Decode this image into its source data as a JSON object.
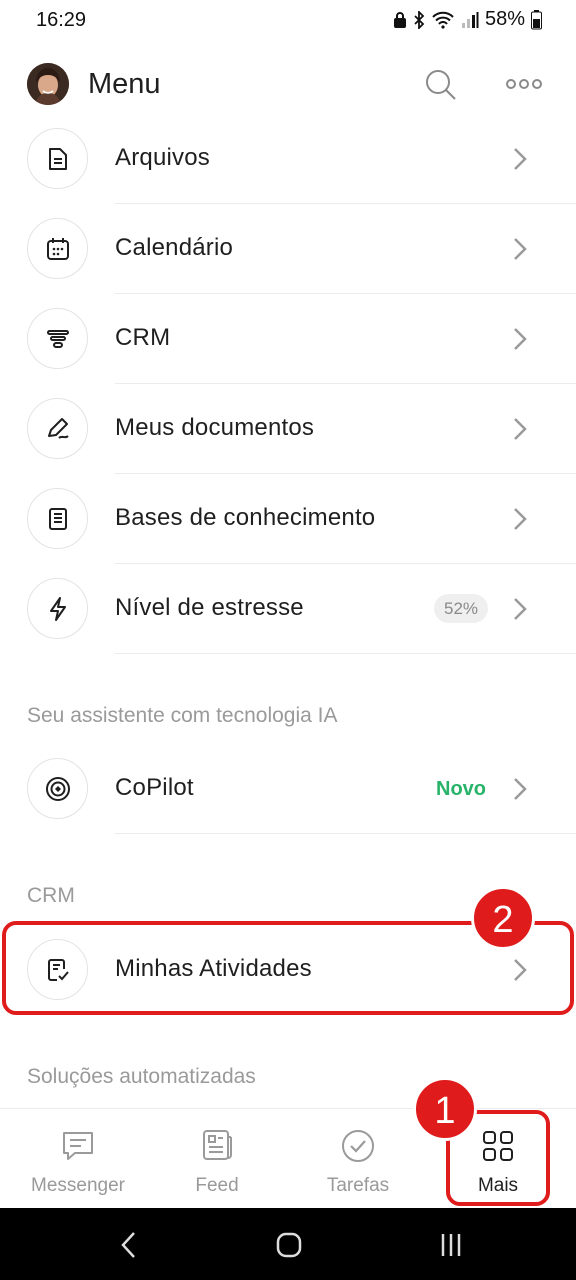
{
  "status": {
    "time": "16:29",
    "battery": "58%"
  },
  "header": {
    "title": "Menu"
  },
  "menu": {
    "items": [
      {
        "label": "Arquivos",
        "icon": "file-icon"
      },
      {
        "label": "Calendário",
        "icon": "calendar-icon"
      },
      {
        "label": "CRM",
        "icon": "funnel-icon"
      },
      {
        "label": "Meus documentos",
        "icon": "pen-icon"
      },
      {
        "label": "Bases de conhecimento",
        "icon": "book-icon"
      },
      {
        "label": "Nível de estresse",
        "icon": "lightning-icon",
        "badge": "52%"
      }
    ]
  },
  "ai_section": {
    "label": "Seu assistente com tecnologia IA",
    "item": {
      "label": "CoPilot",
      "tag": "Novo",
      "icon": "copilot-icon"
    }
  },
  "crm_section": {
    "label": "CRM",
    "item": {
      "label": "Minhas Atividades",
      "icon": "checklist-icon"
    }
  },
  "auto_section": {
    "label": "Soluções automatizadas"
  },
  "annotations": {
    "step1": "1",
    "step2": "2",
    "color": "#e01b1b"
  },
  "tabbar": {
    "tabs": [
      {
        "label": "Messenger",
        "icon": "chat-icon"
      },
      {
        "label": "Feed",
        "icon": "feed-icon"
      },
      {
        "label": "Tarefas",
        "icon": "check-circle-icon"
      },
      {
        "label": "Mais",
        "icon": "grid-icon",
        "active": true
      }
    ]
  },
  "colors": {
    "accent_green": "#28b36a",
    "annotation_red": "#e01b1b",
    "text": "#1f1f1f",
    "muted": "#9a9a9a"
  }
}
